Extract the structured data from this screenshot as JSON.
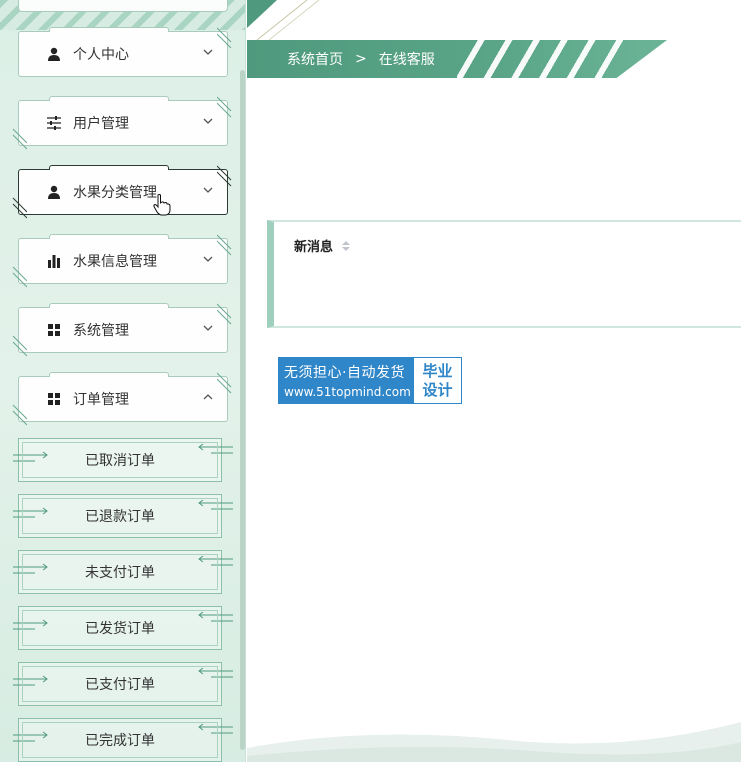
{
  "sidebar": {
    "menu": [
      {
        "label": "个人中心",
        "icon": "user-icon",
        "expanded": false
      },
      {
        "label": "用户管理",
        "icon": "sliders-icon",
        "expanded": false
      },
      {
        "label": "水果分类管理",
        "icon": "user-icon",
        "expanded": false
      },
      {
        "label": "水果信息管理",
        "icon": "bar-chart-icon",
        "expanded": false
      },
      {
        "label": "系统管理",
        "icon": "grid-icon",
        "expanded": false
      },
      {
        "label": "订单管理",
        "icon": "grid-icon",
        "expanded": true
      }
    ],
    "order_submenu": [
      {
        "label": "已取消订单"
      },
      {
        "label": "已退款订单"
      },
      {
        "label": "未支付订单"
      },
      {
        "label": "已发货订单"
      },
      {
        "label": "已支付订单"
      },
      {
        "label": "已完成订单"
      }
    ]
  },
  "breadcrumb": {
    "home": "系统首页",
    "separator": ">",
    "current": "在线客服"
  },
  "message_panel": {
    "column_header": "新消息"
  },
  "ad_banner": {
    "line1": "无须担心·自动发货",
    "line2": "www.51topmind.com",
    "right_top": "毕业",
    "right_bottom": "设计"
  },
  "colors": {
    "accent": "#5aa588",
    "sidebar_bg": "#dcefe6",
    "ad_blue": "#2f86c8"
  }
}
